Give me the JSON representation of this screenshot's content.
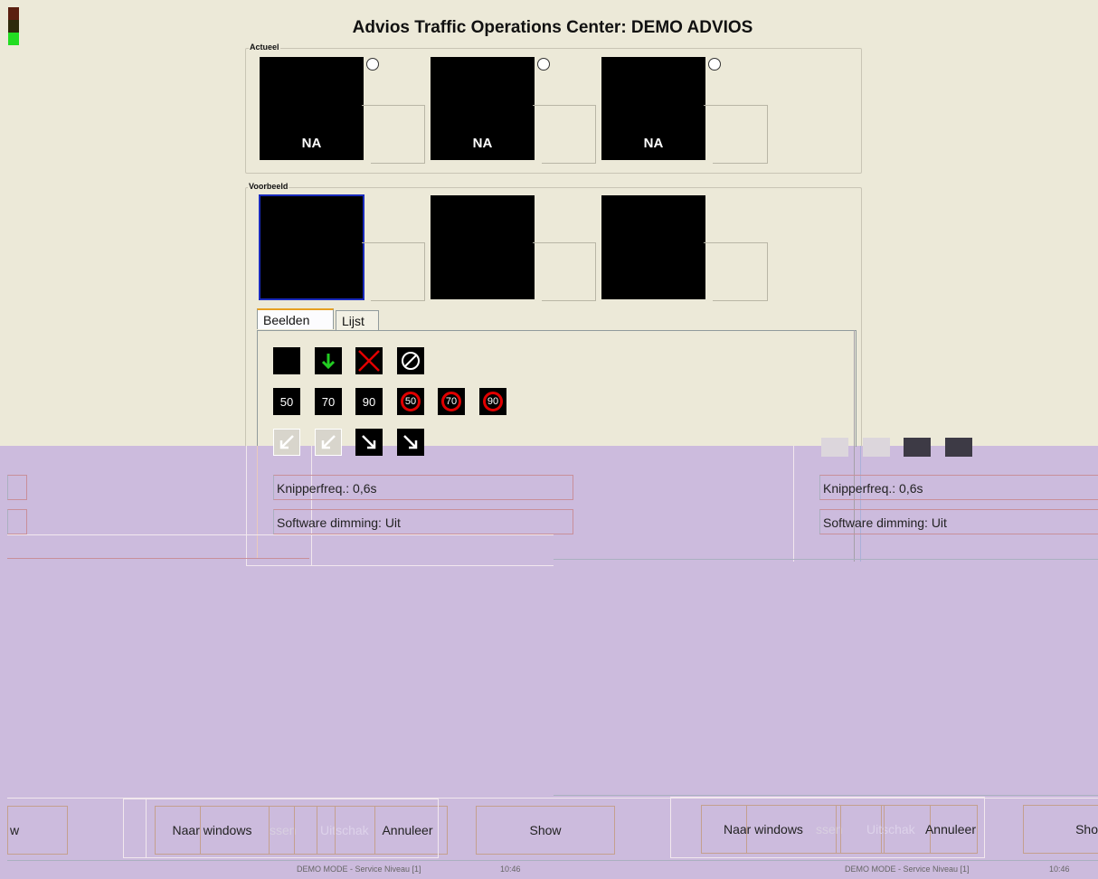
{
  "window": {
    "title": "Advios Traffic Operations Center: DEMO ADVIOS"
  },
  "status_light_colors": [
    "#5a1f10",
    "#2e2a0c",
    "#22dd22"
  ],
  "groups": {
    "actueel": {
      "label": "Actueel",
      "signs": [
        "NA",
        "NA",
        "NA"
      ]
    },
    "voorbeeld": {
      "label": "Voorbeeld"
    }
  },
  "tabs": [
    {
      "label": "Beelden",
      "active": true
    },
    {
      "label": "Lijst",
      "active": false
    }
  ],
  "images": {
    "row1": [
      "blank",
      "arrow-down-green",
      "cross-red",
      "end-restrictions"
    ],
    "row2": [
      "50",
      "70",
      "90",
      "50",
      "70",
      "90"
    ],
    "row3": [
      "arrow-down-left",
      "arrow-down-left",
      "arrow-down-right",
      "arrow-down-right"
    ]
  },
  "fields": {
    "left": {
      "blink": "Knipperfreq.: 0,6s",
      "dimming": "Software dimming: Uit"
    },
    "right": {
      "blink": "Knipperfreq.: 0,6s",
      "dimming": "Software dimming: Uit"
    }
  },
  "buttons": {
    "left": {
      "clipped": "w",
      "naar_windows": "Naar windows",
      "aanpassen_ghost": "ssen",
      "uitschakelen_ghost": "Uitschak",
      "annuleer": "Annuleer",
      "show": "Show"
    },
    "right": {
      "naar_windows": "Naar windows",
      "aanpassen_ghost": "ssen",
      "uitschakelen_ghost": "Uitschak",
      "annuleer": "Annuleer",
      "show": "Sho"
    }
  },
  "statusbar": {
    "left": {
      "mode": "DEMO MODE - Service Niveau [1]",
      "time": "10:46"
    },
    "right": {
      "mode": "DEMO MODE - Service Niveau [1]",
      "time": "10:46"
    }
  },
  "colors": {
    "top_bg": "#ece9d8",
    "bottom_bg": "#ccbbdd",
    "selection": "#1a2bbd",
    "ring": "#e10000",
    "arrow_green": "#22cc22"
  }
}
